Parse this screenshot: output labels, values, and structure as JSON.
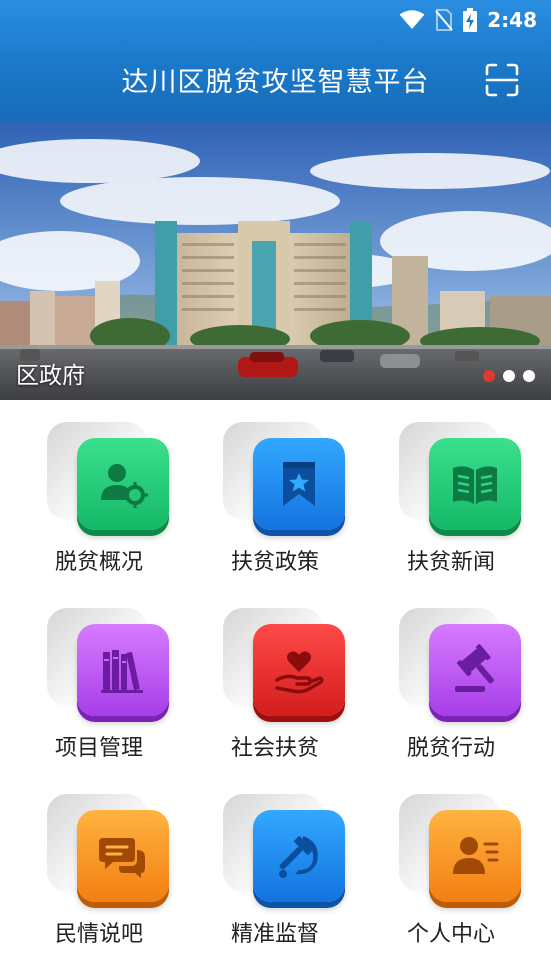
{
  "status_bar": {
    "time": "2:48"
  },
  "header": {
    "title": "达川区脱贫攻坚智慧平台"
  },
  "banner": {
    "caption": "区政府",
    "slides": 3,
    "active_slide": 1
  },
  "menu": [
    {
      "label": "脱贫概况",
      "icon": "user-gear-icon",
      "color": "#1dc774"
    },
    {
      "label": "扶贫政策",
      "icon": "bookmark-star-icon",
      "color": "#1c86ec"
    },
    {
      "label": "扶贫新闻",
      "icon": "open-book-icon",
      "color": "#1dc774"
    },
    {
      "label": "项目管理",
      "icon": "books-icon",
      "color": "#b84ff0"
    },
    {
      "label": "社会扶贫",
      "icon": "heart-hand-icon",
      "color": "#e22a2a"
    },
    {
      "label": "脱贫行动",
      "icon": "gavel-icon",
      "color": "#b84ff0"
    },
    {
      "label": "民情说吧",
      "icon": "chat-bubbles-icon",
      "color": "#f7911f"
    },
    {
      "label": "精准监督",
      "icon": "hammer-sickle-icon",
      "color": "#1c86ec"
    },
    {
      "label": "个人中心",
      "icon": "contact-card-icon",
      "color": "#f7911f"
    }
  ]
}
